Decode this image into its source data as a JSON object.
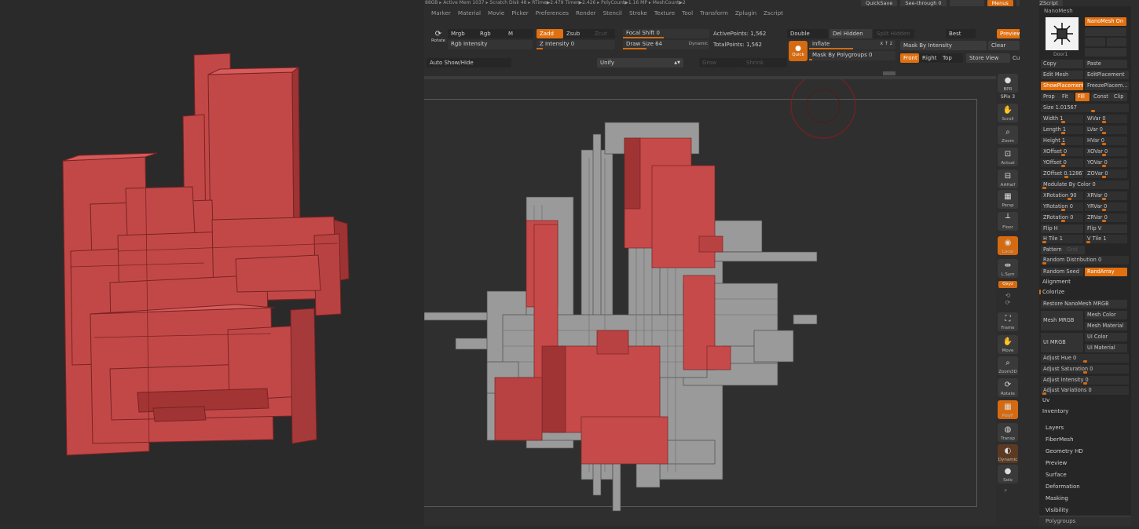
{
  "status": {
    "text": "88GB ▸ Active Mem 1037 ▸ Scratch Disk 48 ▸ RTime▶2.479 Timer▶2.426 ▸ PolyCount▶1.16 MP ▸ MeshCount▶2",
    "quicksave": "QuickSave",
    "seethrough": "See-through  0",
    "menus": "Menus",
    "script": "DefaultZScript"
  },
  "menu": [
    "Marker",
    "Material",
    "Movie",
    "Picker",
    "Preferences",
    "Render",
    "Stencil",
    "Stroke",
    "Texture",
    "Tool",
    "Transform",
    "Zplugin",
    "Zscript"
  ],
  "toolbar": {
    "rotate": "Rotate",
    "mrgb": "Mrgb",
    "rgb": "Rgb",
    "m": "M",
    "zadd": "Zadd",
    "zsub": "Zsub",
    "zcut": "Zcut",
    "rgb_intensity": "Rgb Intensity",
    "z_intensity": "Z Intensity 0",
    "focal_shift": "Focal Shift 0",
    "draw_size": "Draw Size 64",
    "dynamic": "Dynamic",
    "active_points": "ActivePoints: 1,562",
    "total_points": "TotalPoints: 1,562",
    "double": "Double",
    "del_hidden": "Del Hidden",
    "split_hidden": "Split Hidden",
    "best": "Best",
    "preview": "Preview",
    "quick": "Quick",
    "inflate": "Inflate",
    "xyz": "x ↑ z",
    "mask_by_intensity": "Mask By Intensity",
    "clear": "Clear",
    "mask_by_polygroups": "Mask By Polygroups 0",
    "front": "Front",
    "right": "Right",
    "top": "Top",
    "store_view": "Store View",
    "cu": "Cu",
    "auto_show_hide": "Auto Show/Hide",
    "unify": "Unify",
    "grow": "Grow",
    "shrink": "Shrink"
  },
  "shelf": [
    "BPR",
    "SPix 3",
    "Scroll",
    "Zoom",
    "Actual",
    "AAHalf",
    "Persp",
    "Floor",
    "Local",
    "L.Sym",
    "Qxyz",
    "Frame",
    "Move",
    "Zoom3D",
    "Rotate",
    "PolyF",
    "Transp",
    "Dynamic",
    "Solo"
  ],
  "panel": {
    "title": "NanoMesh",
    "nanomesh_on": "NanoMesh On",
    "thumb_label": "Door1",
    "copy": "Copy",
    "paste": "Paste",
    "edit_mesh": "Edit Mesh",
    "edit_placement": "EditPlacement",
    "show_placement": "ShowPlacement",
    "freeze_placement": "FreezePlacem...",
    "prop": "Prop",
    "fit": "Fit",
    "fill": "Fill",
    "const": "Const",
    "clip": "Clip",
    "sliders": [
      [
        "Size 1.01567",
        ""
      ],
      [
        "Width 1",
        "WVar 0"
      ],
      [
        "Length 1",
        "LVar 0"
      ],
      [
        "Height 1",
        "HVar 0"
      ],
      [
        "XOffset 0",
        "XOVar 0"
      ],
      [
        "YOffset 0",
        "YOVar 0"
      ],
      [
        "ZOffset 0.12867",
        "ZOVar 0"
      ],
      [
        "Modulate By Color 0",
        ""
      ],
      [
        "XRotation 90",
        "XRVar 0"
      ],
      [
        "YRotation 0",
        "YRVar 0"
      ],
      [
        "ZRotation 0",
        "ZRVar 0"
      ]
    ],
    "flip_h": "Flip H",
    "flip_v": "Flip V",
    "h_tile": "H Tile 1",
    "v_tile": "V Tile 1",
    "pattern": "Pattern",
    "grid": "Grid",
    "random_distribution": "Random Distribution 0",
    "random_seed": "Random Seed",
    "randarray": "RandArray",
    "alignment": "Alignment",
    "colorize": "Colorize",
    "restore_mrgb": "Restore NanoMesh MRGB",
    "mesh_mrgb": "Mesh MRGB",
    "mesh_color": "Mesh Color",
    "mesh_material": "Mesh Material",
    "ui_mrgb": "UI MRGB",
    "ui_color": "UI Color",
    "ui_material": "UI Material",
    "adjust": [
      "Adjust Hue 0",
      "Adjust Saturation 0",
      "Adjust Intensity 0",
      "Adjust Variations 0"
    ],
    "uv": "Uv",
    "inventory": "Inventory",
    "sections": [
      "Layers",
      "FiberMesh",
      "Geometry HD",
      "Preview",
      "Surface",
      "Deformation",
      "Masking",
      "Visibility"
    ],
    "polygroups": "Polygroups"
  },
  "colors": {
    "accent": "#e07010",
    "mesh_red": "#c64a4a",
    "mesh_gray": "#a8a8a8",
    "background": "#2b2b2b"
  }
}
